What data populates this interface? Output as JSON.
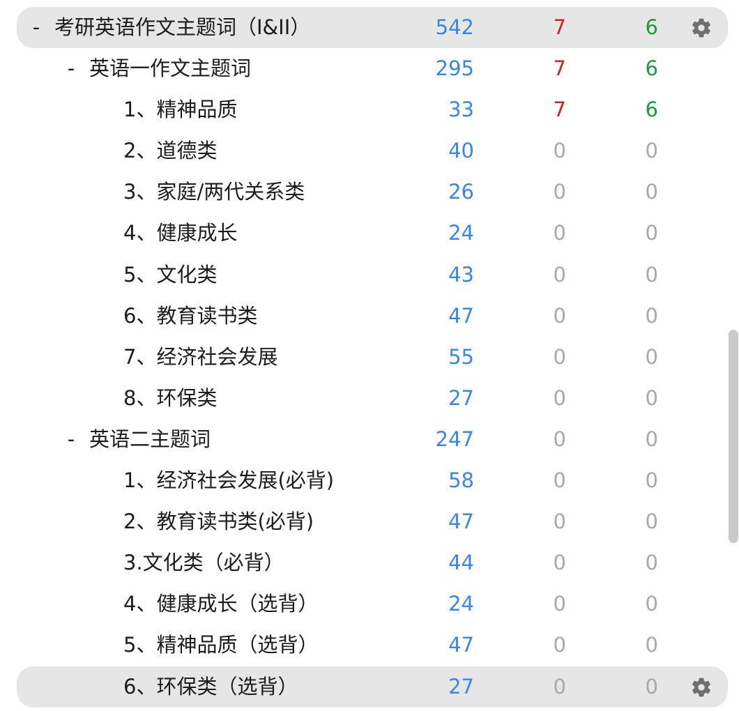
{
  "colors": {
    "new": "#3a86e8",
    "learn": "#cc2222",
    "review": "#1f9a3c",
    "zero": "#a8a8a8",
    "selected_row_bg": "#e6e6e6"
  },
  "decks": [
    {
      "level": 0,
      "collapse": "-",
      "name": "考研英语作文主题词（I&II）",
      "new": "542",
      "learn": "7",
      "review": "6",
      "selected": true,
      "gear": true
    },
    {
      "level": 1,
      "collapse": "-",
      "name": "英语一作文主题词",
      "new": "295",
      "learn": "7",
      "review": "6"
    },
    {
      "level": 2,
      "name": "1、精神品质",
      "new": "33",
      "learn": "7",
      "review": "6"
    },
    {
      "level": 2,
      "name": "2、道德类",
      "new": "40",
      "learn": "0",
      "review": "0"
    },
    {
      "level": 2,
      "name": "3、家庭/两代关系类",
      "new": "26",
      "learn": "0",
      "review": "0"
    },
    {
      "level": 2,
      "name": "4、健康成长",
      "new": "24",
      "learn": "0",
      "review": "0"
    },
    {
      "level": 2,
      "name": "5、文化类",
      "new": "43",
      "learn": "0",
      "review": "0"
    },
    {
      "level": 2,
      "name": "6、教育读书类",
      "new": "47",
      "learn": "0",
      "review": "0"
    },
    {
      "level": 2,
      "name": "7、经济社会发展",
      "new": "55",
      "learn": "0",
      "review": "0"
    },
    {
      "level": 2,
      "name": "8、环保类",
      "new": "27",
      "learn": "0",
      "review": "0"
    },
    {
      "level": 1,
      "collapse": "-",
      "name": "英语二主题词",
      "new": "247",
      "learn": "0",
      "review": "0"
    },
    {
      "level": 2,
      "name": "1、经济社会发展(必背)",
      "new": "58",
      "learn": "0",
      "review": "0"
    },
    {
      "level": 2,
      "name": "2、教育读书类(必背)",
      "new": "47",
      "learn": "0",
      "review": "0"
    },
    {
      "level": 2,
      "name": "3.文化类（必背）",
      "new": "44",
      "learn": "0",
      "review": "0"
    },
    {
      "level": 2,
      "name": "4、健康成长（选背）",
      "new": "24",
      "learn": "0",
      "review": "0"
    },
    {
      "level": 2,
      "name": "5、精神品质（选背）",
      "new": "47",
      "learn": "0",
      "review": "0"
    },
    {
      "level": 2,
      "name": "6、环保类（选背）",
      "new": "27",
      "learn": "0",
      "review": "0",
      "selected": true,
      "gear": true
    }
  ]
}
